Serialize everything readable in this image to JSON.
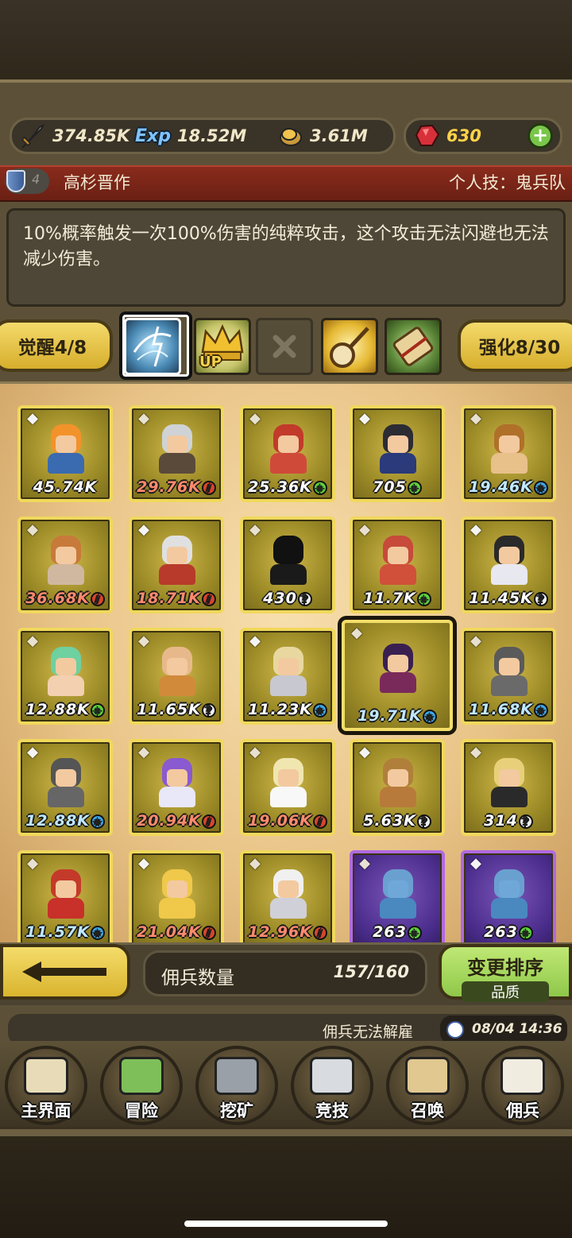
{
  "resources": {
    "attack": "374.85K",
    "exp": "18.52M",
    "gold": "3.61M",
    "gems": "630"
  },
  "hero": {
    "level": "4",
    "name": "高杉晋作",
    "skill": "个人技：鬼兵队",
    "description": "10%概率触发一次100%伤害的纯粹攻击，这个攻击无法闪避也无法减少伤害。"
  },
  "tabs": {
    "awaken": "觉醒4/8",
    "enhance": "强化8/30",
    "up_label": "UP"
  },
  "grid": [
    {
      "val": "45.74K",
      "badge": "",
      "color": "white",
      "frame": "gold"
    },
    {
      "val": "29.76K",
      "badge": "red",
      "color": "red",
      "frame": "gold"
    },
    {
      "val": "25.36K",
      "badge": "green",
      "color": "white",
      "frame": "gold"
    },
    {
      "val": "705",
      "badge": "green",
      "color": "white",
      "frame": "gold"
    },
    {
      "val": "19.46K",
      "badge": "blue",
      "color": "blue",
      "frame": "gold"
    },
    {
      "val": "36.68K",
      "badge": "red",
      "color": "red",
      "frame": "gold"
    },
    {
      "val": "18.71K",
      "badge": "red",
      "color": "red",
      "frame": "gold"
    },
    {
      "val": "430",
      "badge": "white",
      "color": "white",
      "frame": "gold"
    },
    {
      "val": "11.7K",
      "badge": "green",
      "color": "white",
      "frame": "gold"
    },
    {
      "val": "11.45K",
      "badge": "white",
      "color": "white",
      "frame": "gold"
    },
    {
      "val": "12.88K",
      "badge": "green",
      "color": "white",
      "frame": "gold"
    },
    {
      "val": "11.65K",
      "badge": "white",
      "color": "white",
      "frame": "gold"
    },
    {
      "val": "11.23K",
      "badge": "blue",
      "color": "white",
      "frame": "gold"
    },
    {
      "val": "19.71K",
      "badge": "blue",
      "color": "blue",
      "frame": "gold",
      "selected": true
    },
    {
      "val": "11.68K",
      "badge": "blue",
      "color": "blue",
      "frame": "gold"
    },
    {
      "val": "12.88K",
      "badge": "blue",
      "color": "blue",
      "frame": "gold"
    },
    {
      "val": "20.94K",
      "badge": "red",
      "color": "red",
      "frame": "gold"
    },
    {
      "val": "19.06K",
      "badge": "red",
      "color": "red",
      "frame": "gold"
    },
    {
      "val": "5.63K",
      "badge": "white",
      "color": "white",
      "frame": "gold"
    },
    {
      "val": "314",
      "badge": "white",
      "color": "white",
      "frame": "gold"
    },
    {
      "val": "11.57K",
      "badge": "blue",
      "color": "blue",
      "frame": "gold"
    },
    {
      "val": "21.04K",
      "badge": "red",
      "color": "red",
      "frame": "gold"
    },
    {
      "val": "12.96K",
      "badge": "red",
      "color": "red",
      "frame": "gold"
    },
    {
      "val": "263",
      "badge": "green",
      "color": "white",
      "frame": "purple"
    },
    {
      "val": "263",
      "badge": "green",
      "color": "white",
      "frame": "purple"
    }
  ],
  "bottom": {
    "count_label": "佣兵数量",
    "count_value": "157/160",
    "sort_title": "变更排序",
    "sort_sub": "品质",
    "status_msg": "佣兵无法解雇",
    "datetime": "08/04 14:36"
  },
  "nav": [
    {
      "label": "主界面",
      "icon": "map-scroll-icon"
    },
    {
      "label": "冒险",
      "icon": "island-icon"
    },
    {
      "label": "挖矿",
      "icon": "pickaxe-icon"
    },
    {
      "label": "竞技",
      "icon": "crossed-swords-icon"
    },
    {
      "label": "召唤",
      "icon": "summon-scroll-icon"
    },
    {
      "label": "佣兵",
      "icon": "tent-icon"
    }
  ]
}
